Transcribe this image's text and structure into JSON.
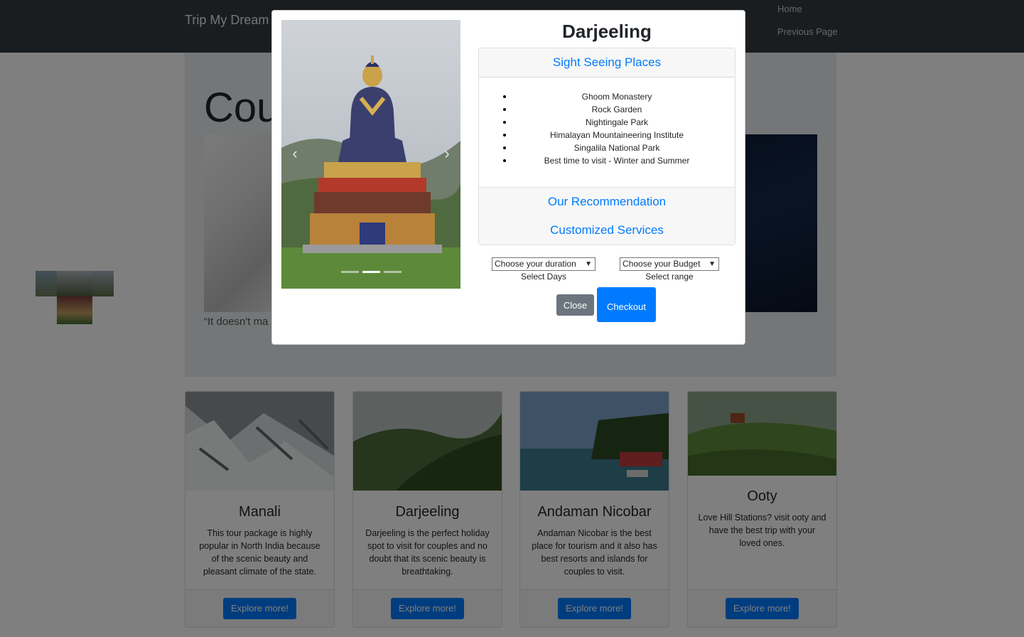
{
  "navbar": {
    "brand": "Trip My Dream",
    "links": [
      "Home",
      "Previous Page"
    ]
  },
  "jumbotron": {
    "title_fragment": "Cou",
    "quote_fragment": "“It doesn't ma"
  },
  "cards": [
    {
      "title": "Manali",
      "text": "This tour package is highly popular in North India because of the scenic beauty and pleasant climate of the state.",
      "button": "Explore more!"
    },
    {
      "title": "Darjeeling",
      "text": "Darjeeling is the perfect holiday spot to visit for couples and no doubt that its scenic beauty is breathtaking.",
      "button": "Explore more!"
    },
    {
      "title": "Andaman Nicobar",
      "text": "Andaman Nicobar is the best place for tourism and it also has best resorts and islands for couples to visit.",
      "button": "Explore more!"
    },
    {
      "title": "Ooty",
      "text": "Love Hill Stations? visit ooty and have the best trip with your loved ones.",
      "button": "Explore more!"
    }
  ],
  "modal": {
    "title": "Darjeeling",
    "carousel": {
      "prev_icon": "chevron-left-icon",
      "next_icon": "chevron-right-icon",
      "slide_count": 3,
      "active_index": 1
    },
    "accordion": {
      "sections": [
        {
          "title": "Sight Seeing Places",
          "expanded": true,
          "items": [
            "Ghoom Monastery",
            "Rock Garden",
            "Nightingale Park",
            "Himalayan Mountaineering Institute",
            "Singalila National Park",
            "Best time to visit - Winter and Summer"
          ]
        },
        {
          "title": "Our Recommendation",
          "expanded": false
        },
        {
          "title": "Customized Services",
          "expanded": false
        }
      ]
    },
    "duration_select": {
      "value": "Choose your duration",
      "label": "Select Days"
    },
    "budget_select": {
      "value": "Choose your Budget",
      "label": "Select range"
    },
    "close_button": "Close",
    "checkout_button": "Checkout"
  },
  "colors": {
    "navbar": "#343a40",
    "primary": "#007bff",
    "secondary": "#6c757d",
    "jumbotron": "#e9ecef"
  }
}
